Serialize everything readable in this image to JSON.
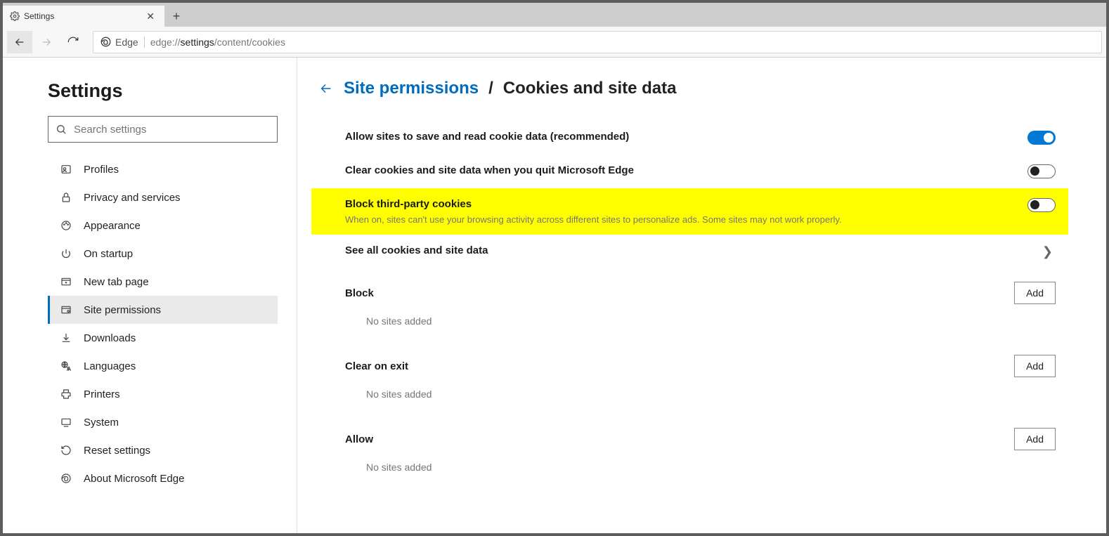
{
  "tab": {
    "title": "Settings"
  },
  "addressbar": {
    "origin_label": "Edge",
    "url_prefix": "edge://",
    "url_highlight": "settings",
    "url_suffix": "/content/cookies"
  },
  "sidebar": {
    "title": "Settings",
    "search_placeholder": "Search settings",
    "items": [
      {
        "label": "Profiles"
      },
      {
        "label": "Privacy and services"
      },
      {
        "label": "Appearance"
      },
      {
        "label": "On startup"
      },
      {
        "label": "New tab page"
      },
      {
        "label": "Site permissions"
      },
      {
        "label": "Downloads"
      },
      {
        "label": "Languages"
      },
      {
        "label": "Printers"
      },
      {
        "label": "System"
      },
      {
        "label": "Reset settings"
      },
      {
        "label": "About Microsoft Edge"
      }
    ]
  },
  "header": {
    "breadcrumb_link": "Site permissions",
    "separator": "/",
    "current": "Cookies and site data"
  },
  "settings": {
    "allow": {
      "title": "Allow sites to save and read cookie data (recommended)"
    },
    "clear_on_quit": {
      "title": "Clear cookies and site data when you quit Microsoft Edge"
    },
    "block_third_party": {
      "title": "Block third-party cookies",
      "desc": "When on, sites can't use your browsing activity across different sites to personalize ads. Some sites may not work properly."
    },
    "see_all": {
      "title": "See all cookies and site data"
    }
  },
  "sections": {
    "block": {
      "title": "Block",
      "add_label": "Add",
      "empty": "No sites added"
    },
    "clear_exit": {
      "title": "Clear on exit",
      "add_label": "Add",
      "empty": "No sites added"
    },
    "allow": {
      "title": "Allow",
      "add_label": "Add",
      "empty": "No sites added"
    }
  }
}
